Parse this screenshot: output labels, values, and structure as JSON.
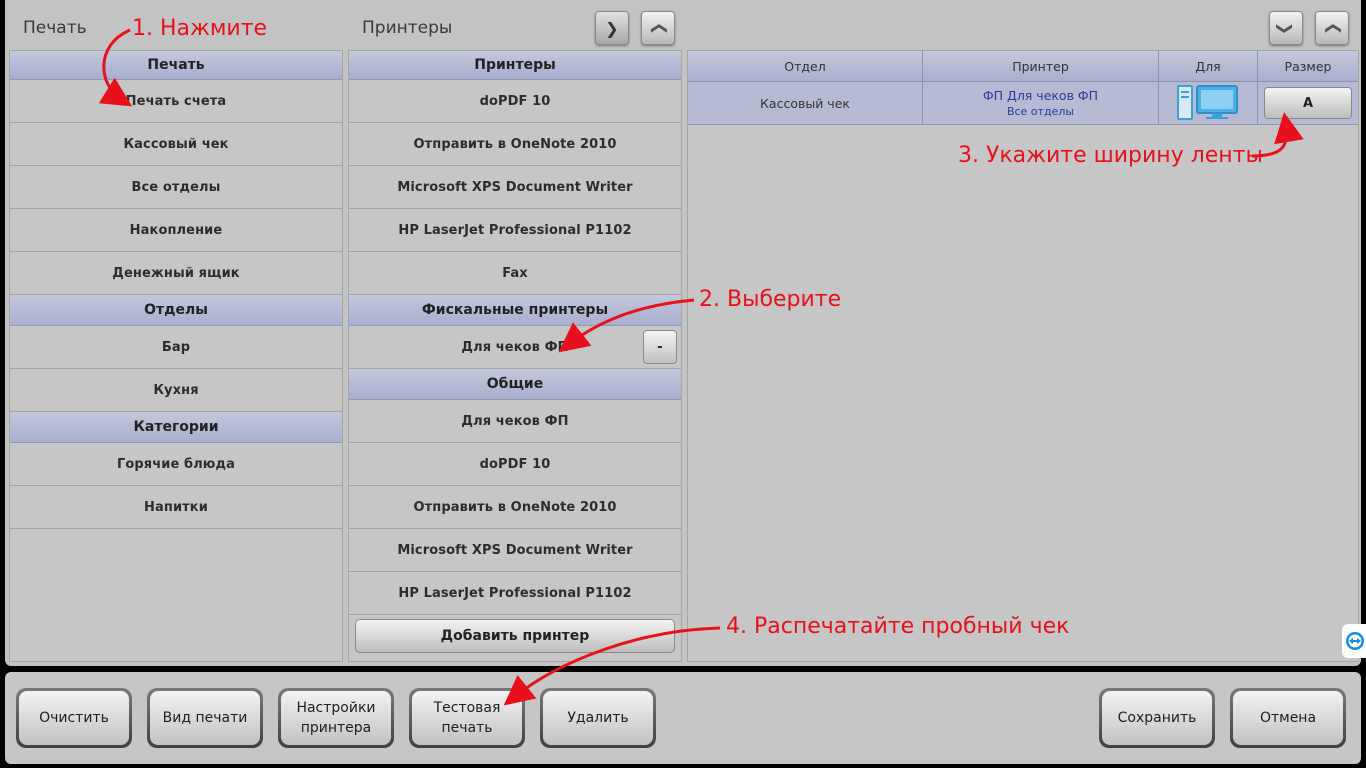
{
  "header": {
    "left_title": "Печать",
    "mid_title": "Принтеры"
  },
  "left_panel": {
    "sections": [
      {
        "title": "Печать",
        "items": [
          "Печать счета",
          "Кассовый чек",
          "Все отделы",
          "Накопление",
          "Денежный ящик"
        ]
      },
      {
        "title": "Отделы",
        "items": [
          "Бар",
          "Кухня"
        ]
      },
      {
        "title": "Категории",
        "items": [
          "Горячие блюда",
          "Напитки"
        ]
      }
    ]
  },
  "mid_panel": {
    "printers_title": "Принтеры",
    "printers": [
      "doPDF 10",
      "Отправить в OneNote 2010",
      "Microsoft XPS Document Writer",
      "HP LaserJet Professional P1102",
      "Fax"
    ],
    "fiscal_title": "Фискальные принтеры",
    "fiscal": [
      "Для чеков ФП"
    ],
    "remove_label": "-",
    "common_title": "Общие",
    "common": [
      "Для чеков ФП",
      "doPDF 10",
      "Отправить в OneNote 2010",
      "Microsoft XPS Document Writer",
      "HP LaserJet Professional P1102"
    ],
    "add_label": "Добавить принтер"
  },
  "right_panel": {
    "columns": [
      "Отдел",
      "Принтер",
      "Для",
      "Размер"
    ],
    "row": {
      "dept": "Кассовый чек",
      "printer_line1": "ФП Для чеков ФП",
      "printer_line2": "Все отделы",
      "for_icon": "monitor-icon",
      "size": "A"
    }
  },
  "bottom": {
    "clear": "Очистить",
    "view": "Вид печати",
    "settings_l1": "Настройки",
    "settings_l2": "принтера",
    "test_l1": "Тестовая",
    "test_l2": "печать",
    "delete": "Удалить",
    "save": "Сохранить",
    "cancel": "Отмена"
  },
  "annotations": {
    "a1": "1. Нажмите",
    "a2": "2. Выберите",
    "a3": "3. Укажите ширину ленты",
    "a4": "4. Распечатайте пробный чек"
  },
  "colors": {
    "annotation": "#e8101a",
    "section_header": "#b0b5d2",
    "selected_row": "#b6bad2"
  }
}
